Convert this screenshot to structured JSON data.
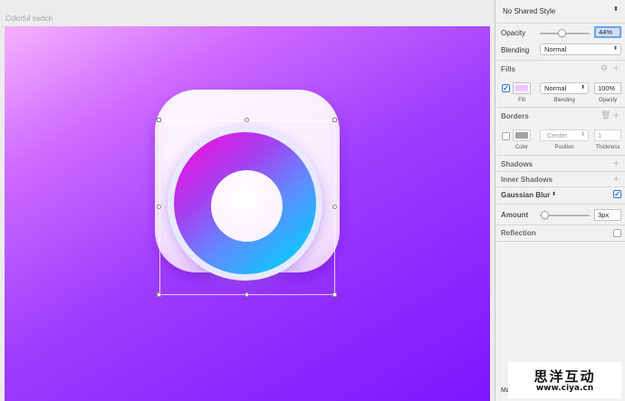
{
  "canvas": {
    "artboard_title": "Colorful switch"
  },
  "inspector": {
    "shared_style": "No Shared Style",
    "opacity": {
      "label": "Opacity",
      "value": "44%",
      "level": 0.44
    },
    "blending": {
      "label": "Blending",
      "value": "Normal"
    },
    "fills": {
      "title": "Fills",
      "enabled": true,
      "blend_value": "Normal",
      "opacity_value": "100%",
      "captions": {
        "fill": "Fill",
        "blending": "Blending",
        "opacity": "Opacity"
      },
      "swatch_color": "#f0c6ff"
    },
    "borders": {
      "title": "Borders",
      "enabled": false,
      "position_value": "Center",
      "thickness_value": "1",
      "captions": {
        "color": "Color",
        "position": "Position",
        "thickness": "Thickness"
      },
      "swatch_color": "#a2a2a2"
    },
    "shadows": {
      "title": "Shadows"
    },
    "inner_shadows": {
      "title": "Inner Shadows"
    },
    "gaussian_blur": {
      "title": "Gaussian Blur",
      "enabled": true
    },
    "amount": {
      "label": "Amount",
      "value": "3px"
    },
    "reflection": {
      "title": "Reflection",
      "enabled": false
    },
    "bottom_partial_label": "Ma"
  },
  "watermark": {
    "chinese": "思洋互动",
    "url": "www.ciya.cn"
  },
  "colors": {
    "gradient_start": "#f6b1ff",
    "gradient_end": "#7d16ff",
    "ring_pink": "#f010dc",
    "ring_cyan": "#00cffd"
  },
  "icons": [
    "gear-icon",
    "trash-icon",
    "plus-icon",
    "chevron-updown-icon",
    "checkmark-icon"
  ]
}
